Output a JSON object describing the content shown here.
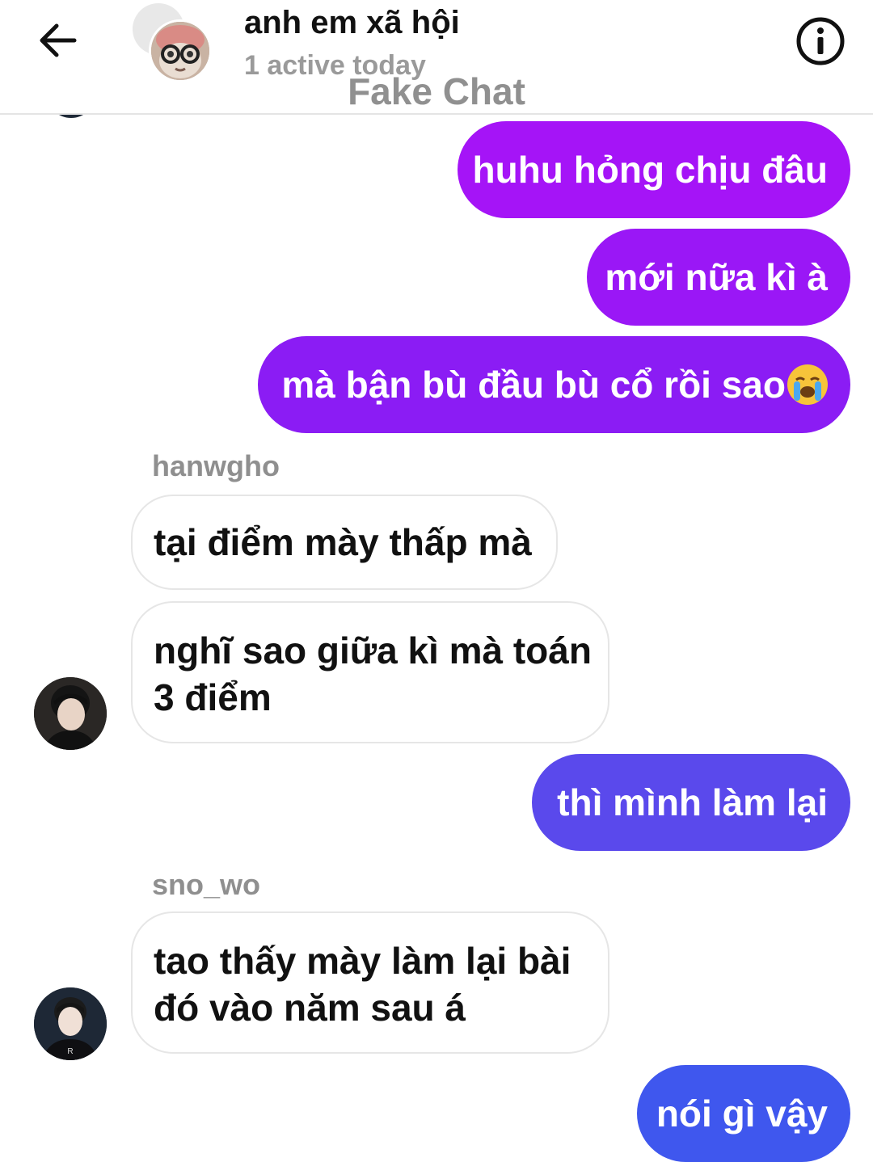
{
  "header": {
    "title": "anh em xã hội",
    "subtitle": "1 active today",
    "watermark": "Fake Chat"
  },
  "messages": {
    "m1": "huhu hỏng chịu đâu",
    "m2": "mới nữa kì à",
    "m3": "mà bận bù đầu bù cổ rồi sao",
    "sender1": "hanwgho",
    "m4": "tại điểm mày thấp mà",
    "m5_line1": "nghĩ sao giữa kì mà toán",
    "m5_line2": "3 điểm",
    "m6": "thì mình làm lại",
    "sender2": "sno_wo",
    "m7_line1": "tao thấy mày làm lại bài",
    "m7_line2": "đó vào năm sau á",
    "m8": "nói gì vậy"
  },
  "icons": {
    "back": "arrow-left-icon",
    "info": "info-circle-icon",
    "emoji": "loudly-crying-face-emoji"
  },
  "colors": {
    "outgoing_top": "#a514f7",
    "outgoing_mid": "#8b1cf4",
    "outgoing_low": "#5a49ec",
    "outgoing_bottom": "#3f57ee",
    "incoming_border": "#e6e6e6",
    "sender_name": "#8f8f8f"
  }
}
